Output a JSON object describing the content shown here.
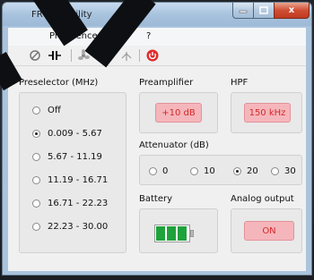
{
  "window": {
    "title": "FR4003Utility",
    "close_glyph": "x"
  },
  "menubar": {
    "items": [
      "Preference",
      "s",
      "?"
    ]
  },
  "toolbar": {
    "temperature_unit": "°C"
  },
  "preselector": {
    "label": "Preselector (MHz)",
    "options": [
      "Off",
      "0.009 - 5.67",
      "5.67 - 11.19",
      "11.19 - 16.71",
      "16.71 - 22.23",
      "22.23 - 30.00"
    ],
    "selected": "0.009 - 5.67"
  },
  "preamplifier": {
    "label": "Preamplifier",
    "button": "+10 dB"
  },
  "hpf": {
    "label": "HPF",
    "button": "150 kHz"
  },
  "attenuator": {
    "label": "Attenuator (dB)",
    "options": [
      "0",
      "10",
      "20",
      "30"
    ],
    "selected": "20"
  },
  "battery": {
    "label": "Battery",
    "level_fraction": 0.75
  },
  "analog_output": {
    "label": "Analog output",
    "button": "ON"
  },
  "colors": {
    "accent_pink": "#f5b6bb",
    "accent_red_text": "#d42a2a",
    "battery_green": "#1fa23c",
    "close_red": "#c03a22"
  }
}
